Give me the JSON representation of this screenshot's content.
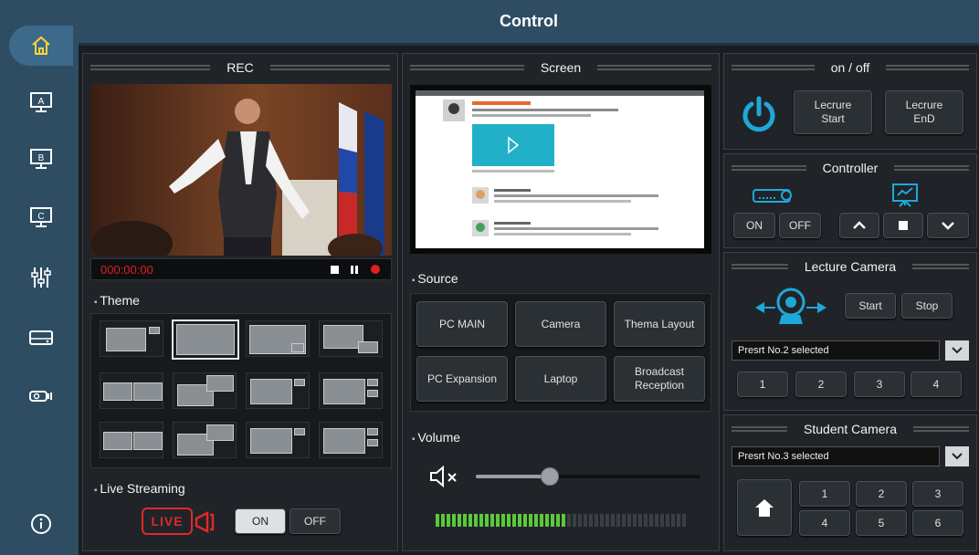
{
  "title": "Control",
  "sidebar": {
    "items": [
      {
        "icon": "home-icon"
      },
      {
        "label": "A"
      },
      {
        "label": "B"
      },
      {
        "label": "C"
      },
      {
        "icon": "mixer-icon"
      },
      {
        "icon": "recorder-icon"
      },
      {
        "icon": "projector-icon"
      },
      {
        "icon": "info-icon"
      }
    ]
  },
  "rec": {
    "title": "REC",
    "timecode": "000:00:00"
  },
  "theme": {
    "title": "Theme"
  },
  "live": {
    "title": "Live Streaming",
    "badge": "LIVE",
    "on": "ON",
    "off": "OFF"
  },
  "screen": {
    "title": "Screen"
  },
  "source": {
    "title": "Source",
    "buttons": [
      "PC MAIN",
      "Camera",
      "Thema Layout",
      "PC Expansion",
      "Laptop",
      "Broadcast Reception"
    ]
  },
  "volume": {
    "title": "Volume",
    "level": 0.55
  },
  "onoff": {
    "title": "on / off",
    "start": "Lecrure Start",
    "end": "Lecrure EnD"
  },
  "controller": {
    "title": "Controller",
    "on": "ON",
    "off": "OFF"
  },
  "lecture_camera": {
    "title": "Lecture Camera",
    "start": "Start",
    "stop": "Stop",
    "preset": "Presrt No.2 selected",
    "presets": [
      "1",
      "2",
      "3",
      "4"
    ]
  },
  "student_camera": {
    "title": "Student Camera",
    "preset": "Presrt No.3 selected",
    "presets": [
      "1",
      "2",
      "3",
      "4",
      "5",
      "6"
    ]
  },
  "colors": {
    "accent": "#1ea8d8",
    "live": "#e02828",
    "rec_dot": "#e02020"
  }
}
